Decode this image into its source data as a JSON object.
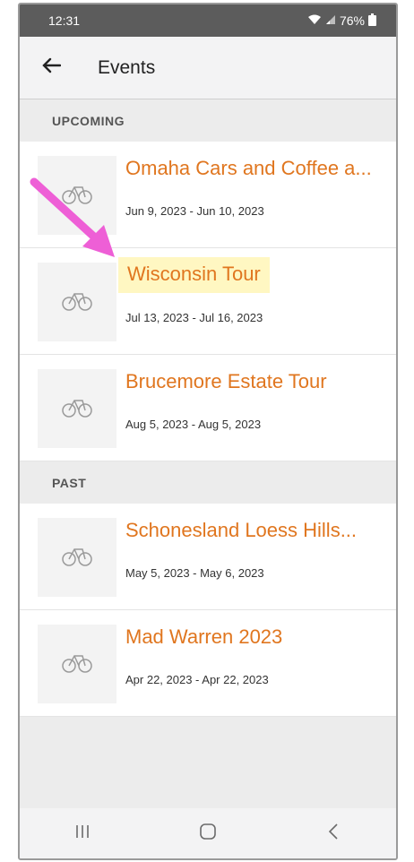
{
  "status": {
    "time": "12:31",
    "battery": "76%"
  },
  "appbar": {
    "title": "Events"
  },
  "sections": {
    "upcoming": "UPCOMING",
    "past": "PAST"
  },
  "upcoming": [
    {
      "title": "Omaha Cars and Coffee a...",
      "dates": "Jun 9, 2023 - Jun 10, 2023"
    },
    {
      "title": "Wisconsin Tour",
      "dates": "Jul 13, 2023 - Jul 16, 2023"
    },
    {
      "title": "Brucemore Estate Tour",
      "dates": "Aug 5, 2023 - Aug 5, 2023"
    }
  ],
  "past": [
    {
      "title": "Schonesland Loess Hills...",
      "dates": "May 5, 2023 - May 6, 2023"
    },
    {
      "title": "Mad Warren 2023",
      "dates": "Apr 22, 2023 - Apr 22, 2023"
    }
  ],
  "icons": {
    "back": "back-arrow-icon",
    "thumb": "bicycle-icon",
    "wifi": "wifi-icon",
    "signal": "signal-icon",
    "battery": "battery-icon",
    "recents": "recents-icon",
    "home": "home-icon",
    "nav_back": "back-chevron-icon",
    "annotation": "pointer-arrow-annotation"
  },
  "colors": {
    "accent": "#e0761f",
    "highlight": "#fff7c2",
    "annotation": "#ee5fd6",
    "statusbar": "#5c5c5c"
  }
}
